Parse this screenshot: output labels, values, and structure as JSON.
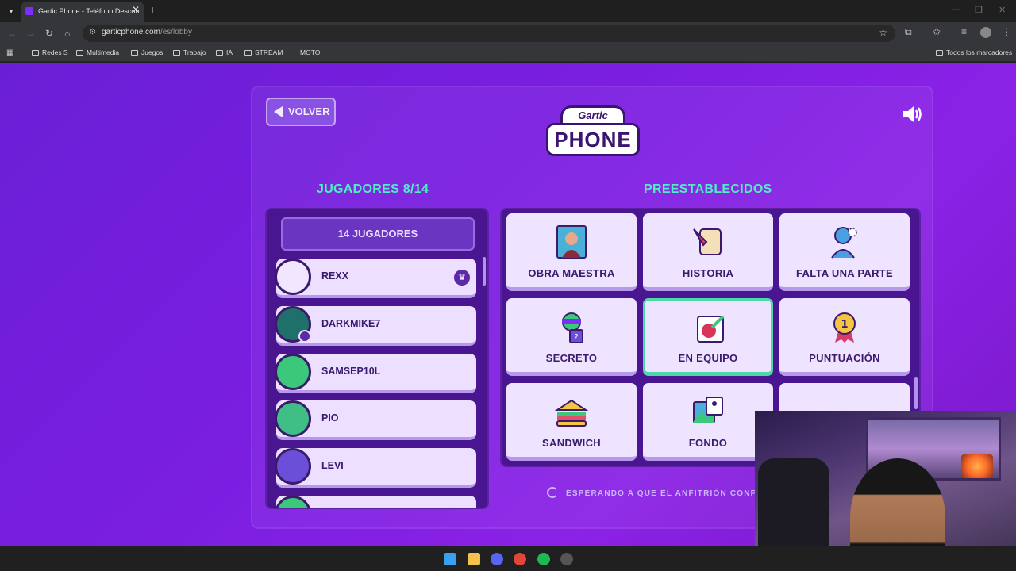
{
  "browser": {
    "tab_title": "Gartic Phone - Teléfono Descon",
    "url_host": "garticphone.com",
    "url_path": "/es/lobby",
    "bookmarks": [
      "Redes S",
      "Multimedia",
      "Juegos",
      "Trabajo",
      "IA",
      "STREAM",
      "MOTO"
    ],
    "all_bookmarks": "Todos los marcadores"
  },
  "lobby": {
    "back_label": "VOLVER",
    "logo_top": "Gartic",
    "logo_bottom": "PHONE",
    "players_heading": "JUGADORES 8/14",
    "presets_heading": "PREESTABLECIDOS",
    "player_count_button": "14 JUGADORES",
    "players": [
      {
        "name": "REXX",
        "host": true,
        "color": "#f2e6ff"
      },
      {
        "name": "DARKMIKE7",
        "host": false,
        "color": "#1f6f6a"
      },
      {
        "name": "SAMSEP10L",
        "host": false,
        "color": "#3cc87a"
      },
      {
        "name": "PIO",
        "host": false,
        "color": "#3fbf86"
      },
      {
        "name": "LEVI",
        "host": false,
        "color": "#6b4fd8"
      }
    ],
    "presets": [
      {
        "label": "OBRA MAESTRA",
        "icon": "mona-lisa-icon"
      },
      {
        "label": "HISTORIA",
        "icon": "scroll-quill-icon"
      },
      {
        "label": "FALTA UNA PARTE",
        "icon": "missing-piece-icon"
      },
      {
        "label": "SECRETO",
        "icon": "ninja-icon"
      },
      {
        "label": "EN EQUIPO",
        "icon": "team-pencil-icon",
        "selected": true
      },
      {
        "label": "PUNTUACIÓN",
        "icon": "medal-icon"
      },
      {
        "label": "SANDWICH",
        "icon": "sandwich-icon"
      },
      {
        "label": "FONDO",
        "icon": "background-picture-icon"
      }
    ],
    "waiting_text": "ESPERANDO A QUE EL ANFITRIÓN CONFIGU"
  },
  "colors": {
    "accent_green": "#4cf0c4",
    "page_purple": "#7a1ee0",
    "card_bg": "#eee4ff",
    "text_dark": "#3b1a6e"
  }
}
